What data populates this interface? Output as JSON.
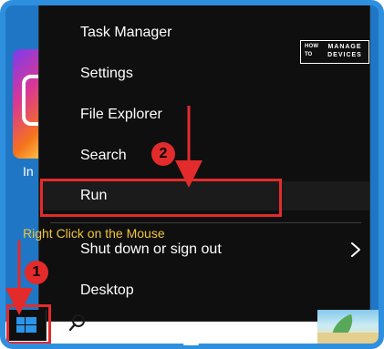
{
  "menu": {
    "items": [
      {
        "label": "Task Manager"
      },
      {
        "label": "Settings"
      },
      {
        "label": "File Explorer"
      },
      {
        "label": "Search"
      },
      {
        "label": "Run"
      },
      {
        "label": "Shut down or sign out"
      },
      {
        "label": "Desktop"
      }
    ]
  },
  "desktop": {
    "app_label": "In"
  },
  "brand": {
    "top_left": "HOW",
    "bottom_left": "TO",
    "top_right": "MANAGE",
    "bottom_right": "DEVICES"
  },
  "annotations": {
    "callout_text": "Right Click on the Mouse",
    "badge_1": "1",
    "badge_2": "2",
    "accent_color": "#e32b2b",
    "callout_color": "#f0c43b"
  },
  "icons": {
    "start_icon": "windows-start-icon",
    "search_icon": "search-icon",
    "submenu_icon": "chevron-right-icon"
  },
  "colors": {
    "menu_background": "#0f0f10",
    "desktop_background": "#1f76c5",
    "frame_border": "#2f8fdf"
  }
}
